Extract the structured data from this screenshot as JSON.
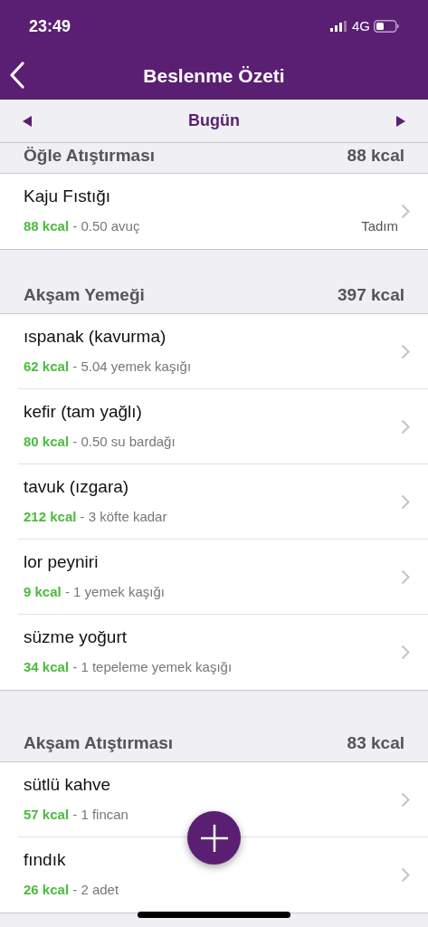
{
  "status_bar": {
    "time": "23:49",
    "network": "4G"
  },
  "header": {
    "title": "Beslenme Özeti"
  },
  "date_bar": {
    "label": "Bugün"
  },
  "sections": [
    {
      "title": "Öğle Atıştırması",
      "total": "88 kcal",
      "items": [
        {
          "name": "Kaju Fıstığı",
          "detail": "**88 kcal** - 0.50 avuç",
          "brand": "Tadım"
        }
      ]
    },
    {
      "title": "Akşam Yemeği",
      "total": "397 kcal",
      "items": [
        {
          "name": "ıspanak (kavurma)",
          "detail": "**62 kcal** - 5.04 yemek kaşığı"
        },
        {
          "name": "kefir (tam yağlı)",
          "detail": "**80 kcal** - 0.50 su bardağı"
        },
        {
          "name": "tavuk (ızgara)",
          "detail": "**212 kcal** - 3 köfte kadar"
        },
        {
          "name": "lor peyniri",
          "detail": "**9 kcal** - 1 yemek kaşığı"
        },
        {
          "name": "süzme yoğurt",
          "detail": "**34 kcal** - 1 tepeleme yemek kaşığı"
        }
      ]
    },
    {
      "title": "Akşam Atıştırması",
      "total": "83 kcal",
      "items": [
        {
          "name": "sütlü kahve",
          "detail": "**57 kcal** - 1 fincan"
        },
        {
          "name": "fındık",
          "detail": "**26 kcal** - 2 adet"
        }
      ]
    }
  ]
}
